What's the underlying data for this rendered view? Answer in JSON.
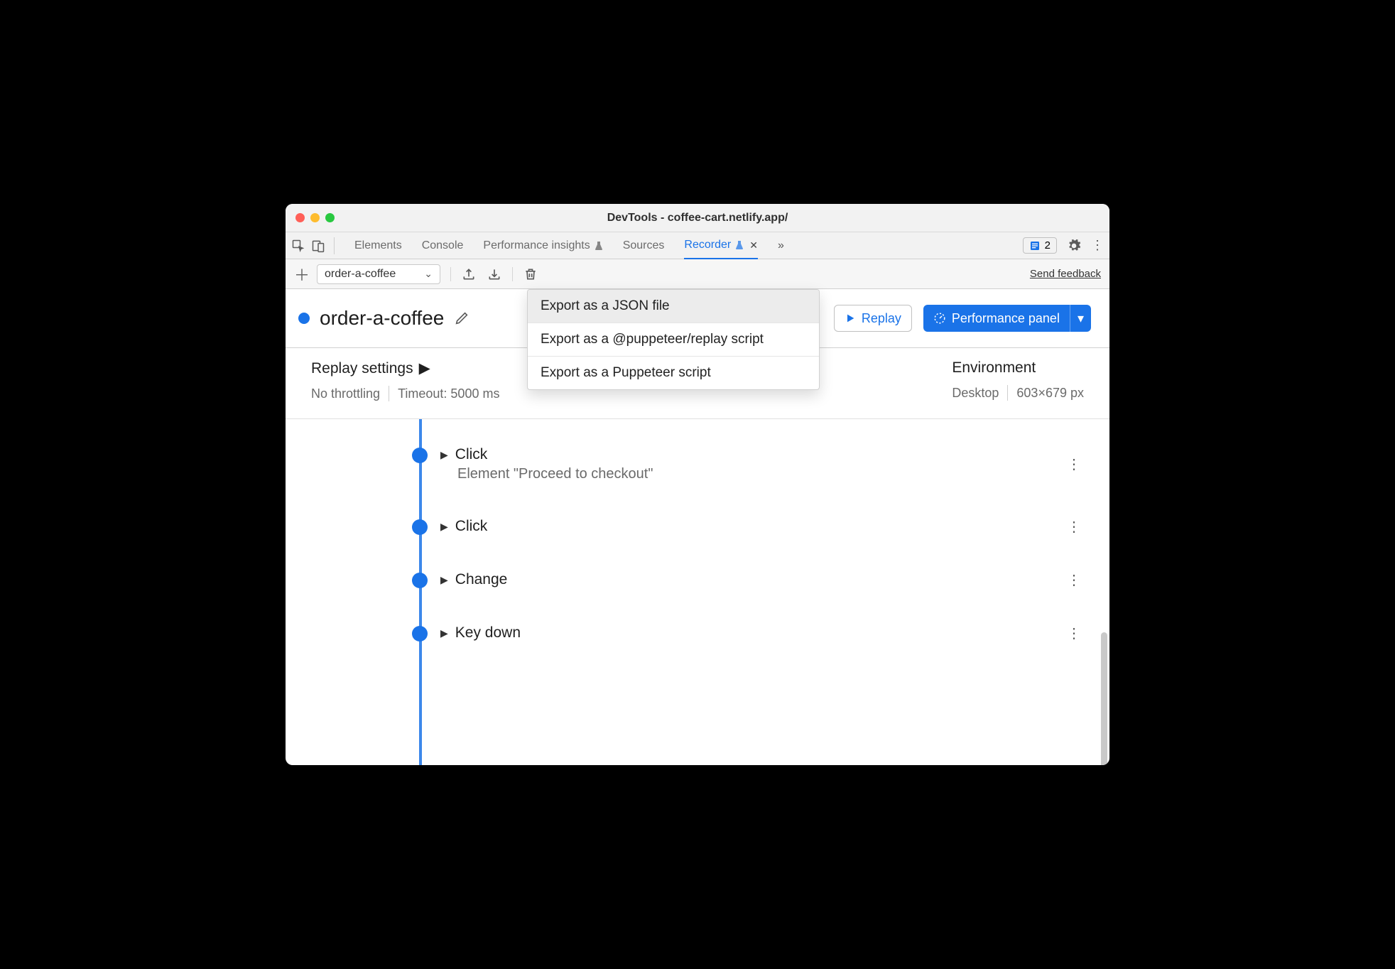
{
  "window": {
    "title": "DevTools - coffee-cart.netlify.app/"
  },
  "tabs": {
    "elements": "Elements",
    "console": "Console",
    "perf_insights": "Performance insights",
    "sources": "Sources",
    "recorder": "Recorder"
  },
  "tabstrip": {
    "issues_count": "2"
  },
  "toolbar": {
    "recording_name": "order-a-coffee",
    "feedback": "Send feedback"
  },
  "header": {
    "recording_title": "order-a-coffee",
    "replay_label": "Replay",
    "perf_label": "Performance panel"
  },
  "export_menu": {
    "item1": "Export as a JSON file",
    "item2": "Export as a @puppeteer/replay script",
    "item3": "Export as a Puppeteer script"
  },
  "settings": {
    "replay_title": "Replay settings",
    "throttling": "No throttling",
    "timeout": "Timeout: 5000 ms",
    "env_title": "Environment",
    "env_device": "Desktop",
    "env_size": "603×679 px"
  },
  "steps": [
    {
      "name": "Click",
      "subtitle": "Element \"Proceed to checkout\""
    },
    {
      "name": "Click",
      "subtitle": ""
    },
    {
      "name": "Change",
      "subtitle": ""
    },
    {
      "name": "Key down",
      "subtitle": ""
    }
  ]
}
